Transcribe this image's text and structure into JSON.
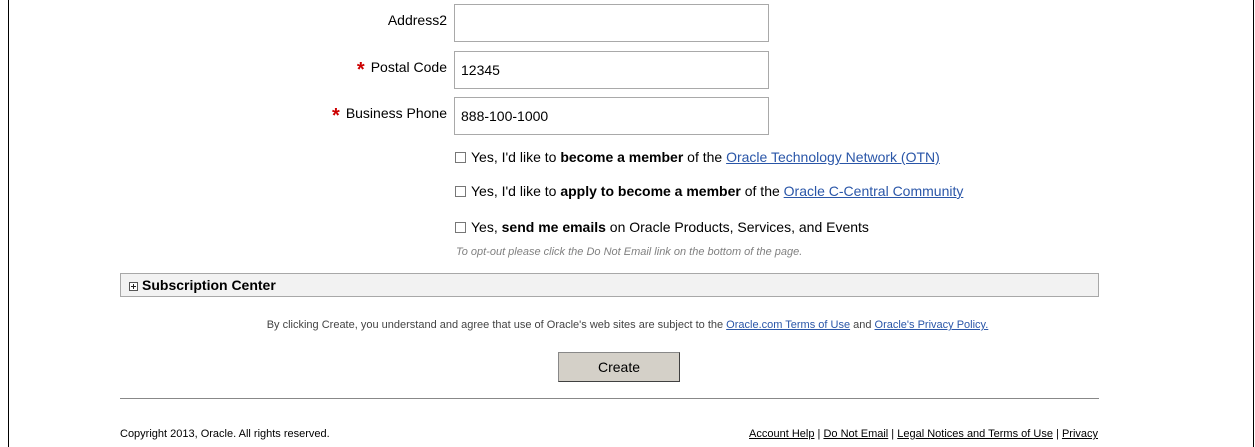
{
  "form": {
    "address2": {
      "label": "Address2",
      "value": ""
    },
    "postal_code": {
      "label": "Postal Code",
      "value": "12345"
    },
    "business_phone": {
      "label": "Business Phone",
      "value": "888-100-1000"
    },
    "required_mark": "*"
  },
  "checkboxes": {
    "otn": {
      "prefix": "Yes, I'd like to ",
      "bold": "become a member",
      "middle": " of the ",
      "link": "Oracle Technology Network (OTN)",
      "checked": false
    },
    "ccentral": {
      "prefix": "Yes, I'd like to ",
      "bold": "apply to become a member",
      "middle": " of the ",
      "link": "Oracle C-Central Community",
      "checked": false
    },
    "emails": {
      "prefix": "Yes, ",
      "bold": "send me emails",
      "suffix": " on Oracle Products, Services, and Events",
      "checked": false
    },
    "optout_note": "To opt-out please click the Do Not Email link on the bottom of the page."
  },
  "subscription_center": {
    "label": "Subscription Center",
    "expanded": false
  },
  "agreement": {
    "text": "By clicking Create, you understand and agree that use of Oracle's web sites are subject to the ",
    "terms_link": "Oracle.com Terms of Use",
    "and": " and ",
    "privacy_link": "Oracle's Privacy Policy."
  },
  "create_button": "Create",
  "footer": {
    "copyright": "Copyright 2013, Oracle. All rights reserved.",
    "links": [
      "Account Help",
      "Do Not Email",
      "Legal Notices and Terms of Use",
      "Privacy"
    ],
    "separator": " | "
  }
}
